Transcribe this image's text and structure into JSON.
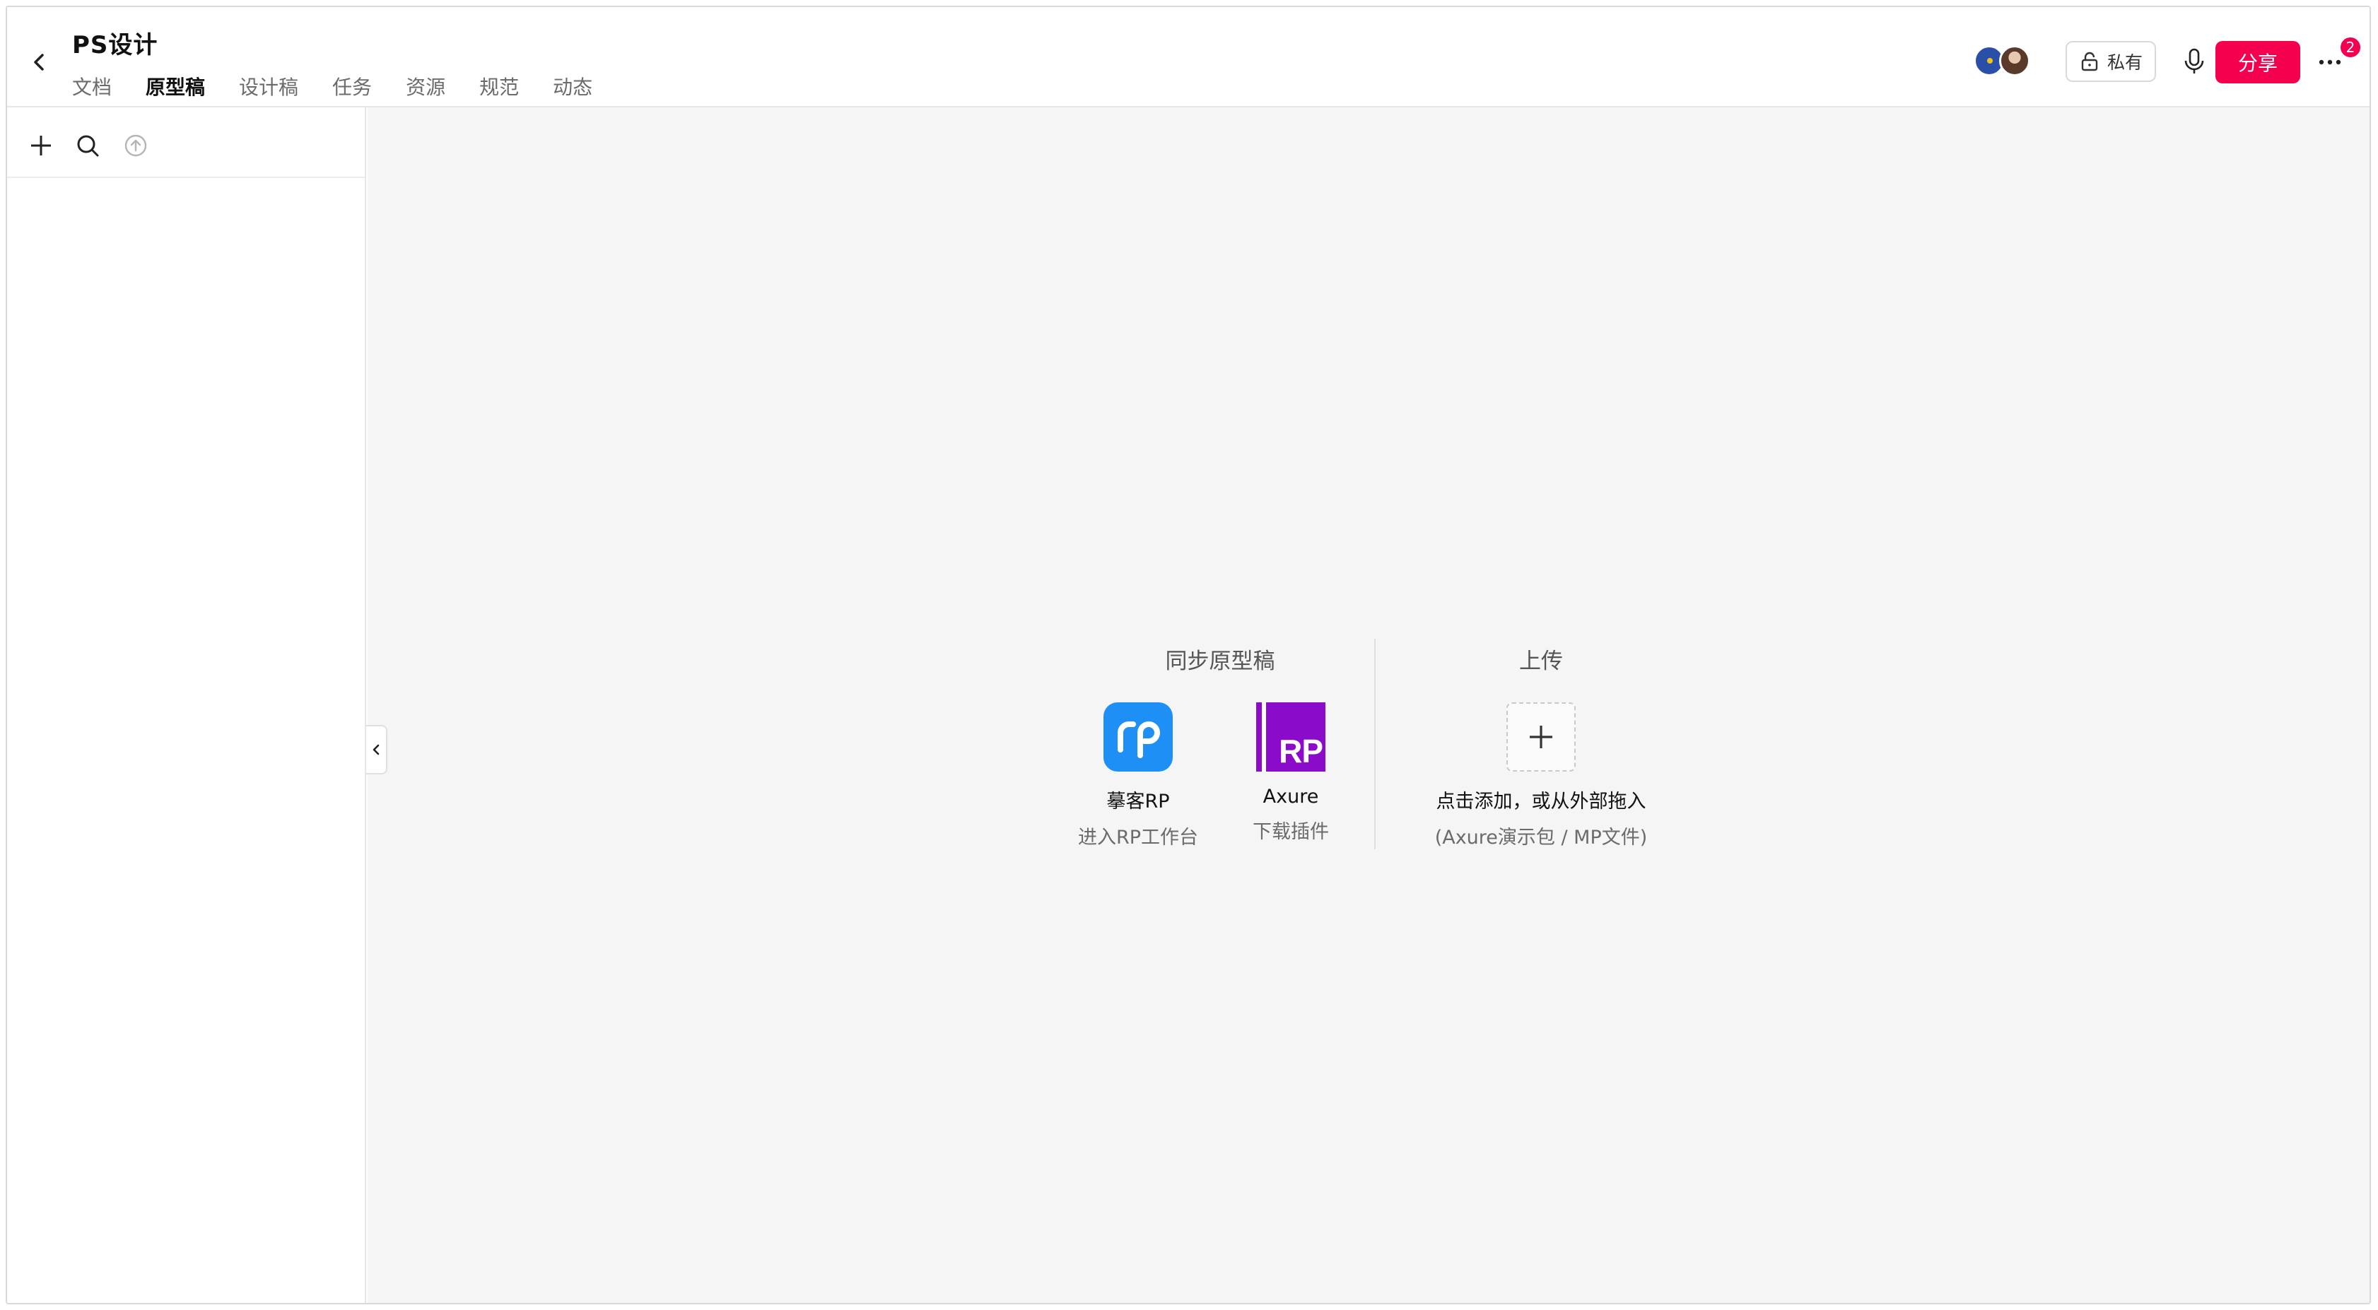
{
  "header": {
    "title": "PS设计",
    "tabs": [
      {
        "label": "文档",
        "active": false
      },
      {
        "label": "原型稿",
        "active": true
      },
      {
        "label": "设计稿",
        "active": false
      },
      {
        "label": "任务",
        "active": false
      },
      {
        "label": "资源",
        "active": false
      },
      {
        "label": "规范",
        "active": false
      },
      {
        "label": "动态",
        "active": false
      }
    ],
    "private_label": "私有",
    "share_label": "分享",
    "notification_count": "2"
  },
  "sync": {
    "title": "同步原型稿",
    "tools": [
      {
        "name": "摹客RP",
        "sub": "进入RP工作台",
        "icon": "rp-logo-icon"
      },
      {
        "name": "Axure",
        "sub": "下载插件",
        "icon": "axure-logo-icon",
        "logo_text": "RP"
      }
    ]
  },
  "upload": {
    "title": "上传",
    "action": "点击添加，或从外部拖入",
    "hint": "(Axure演示包 / MP文件)"
  },
  "colors": {
    "accent": "#f5004f",
    "rp_blue": "#1e8ff5",
    "axure_purple": "#8a0bc9",
    "canvas_bg": "#f5f5f5"
  }
}
